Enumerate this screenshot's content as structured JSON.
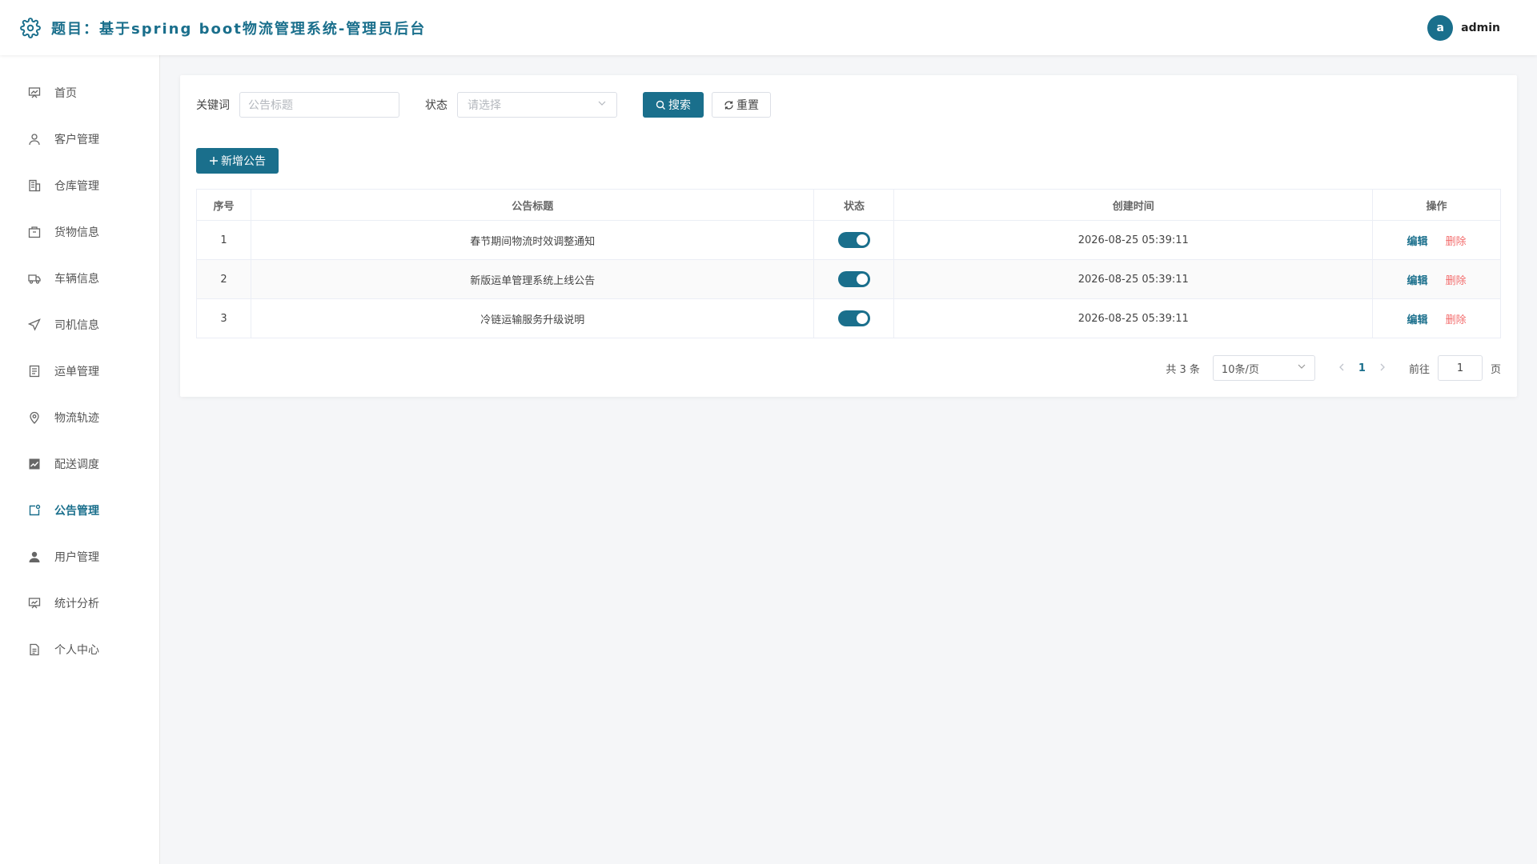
{
  "header": {
    "title": "题目：基于spring boot物流管理系统-管理员后台",
    "avatar_letter": "a",
    "username": "admin",
    "logo_icon": "gear-icon"
  },
  "sidebar": {
    "items": [
      {
        "label": "首页",
        "icon": "dashboard-icon",
        "active": false
      },
      {
        "label": "客户管理",
        "icon": "user-icon",
        "active": false
      },
      {
        "label": "仓库管理",
        "icon": "building-icon",
        "active": false
      },
      {
        "label": "货物信息",
        "icon": "package-icon",
        "active": false
      },
      {
        "label": "车辆信息",
        "icon": "truck-icon",
        "active": false
      },
      {
        "label": "司机信息",
        "icon": "send-icon",
        "active": false
      },
      {
        "label": "运单管理",
        "icon": "document-icon",
        "active": false
      },
      {
        "label": "物流轨迹",
        "icon": "location-icon",
        "active": false
      },
      {
        "label": "配送调度",
        "icon": "chart-icon",
        "active": false
      },
      {
        "label": "公告管理",
        "icon": "notice-icon",
        "active": true
      },
      {
        "label": "用户管理",
        "icon": "user-filled-icon",
        "active": false
      },
      {
        "label": "统计分析",
        "icon": "presentation-icon",
        "active": false
      },
      {
        "label": "个人中心",
        "icon": "profile-doc-icon",
        "active": false
      }
    ]
  },
  "filters": {
    "keyword_label": "关键词",
    "keyword_placeholder": "公告标题",
    "status_label": "状态",
    "status_placeholder": "请选择",
    "search_label": "搜索",
    "reset_label": "重置"
  },
  "actions": {
    "add_label": "新增公告"
  },
  "table": {
    "headers": [
      "序号",
      "公告标题",
      "状态",
      "创建时间",
      "操作"
    ],
    "rows": [
      {
        "index": "1",
        "title": "春节期间物流时效调整通知",
        "status_on": true,
        "created": "2026-08-25 05:39:11"
      },
      {
        "index": "2",
        "title": "新版运单管理系统上线公告",
        "status_on": true,
        "created": "2026-08-25 05:39:11"
      },
      {
        "index": "3",
        "title": "冷链运输服务升级说明",
        "status_on": true,
        "created": "2026-08-25 05:39:11"
      }
    ],
    "edit_label": "编辑",
    "delete_label": "删除"
  },
  "pagination": {
    "total_text": "共 3 条",
    "page_size": "10条/页",
    "current_page": "1",
    "goto_label": "前往",
    "goto_value": "1",
    "page_suffix": "页"
  },
  "colors": {
    "primary": "#1a6f8c",
    "danger": "#f36c6c"
  }
}
